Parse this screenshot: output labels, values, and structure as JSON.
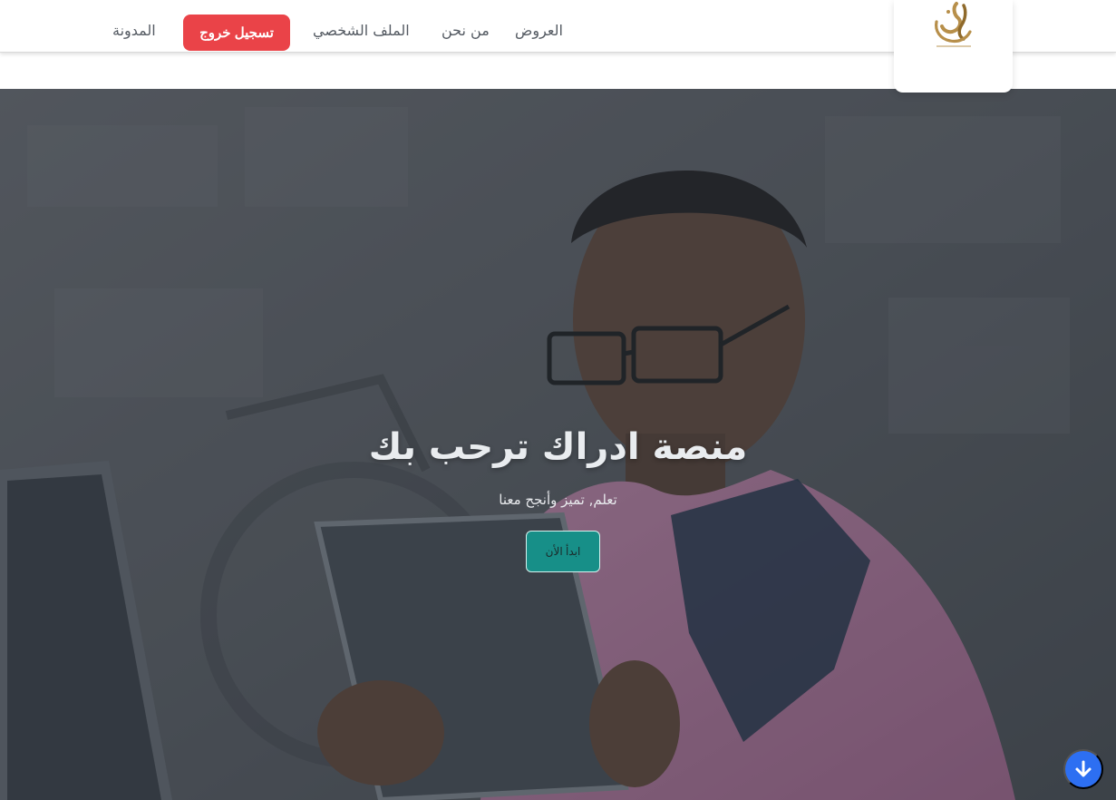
{
  "nav": {
    "links": [
      "العروض",
      "من نحن",
      "الملف الشخصي"
    ],
    "logout_label": "تسجيل خروج",
    "blog_label": "المدونة"
  },
  "logo": {
    "icon": "edrak-calligraphy-logo",
    "brand_colors": [
      "#b78f4a",
      "#8f6a2b"
    ]
  },
  "hero": {
    "title": "منصة ادراك ترحب بك",
    "subtitle": "تعلم, تميز وأنجح معنا",
    "cta_label": "ابدأ الأن"
  },
  "scroll_button": {
    "icon": "arrow-down-icon",
    "color": "#2d6ff2"
  },
  "colors": {
    "logout": "#ea4348",
    "cta": "#178f88"
  }
}
